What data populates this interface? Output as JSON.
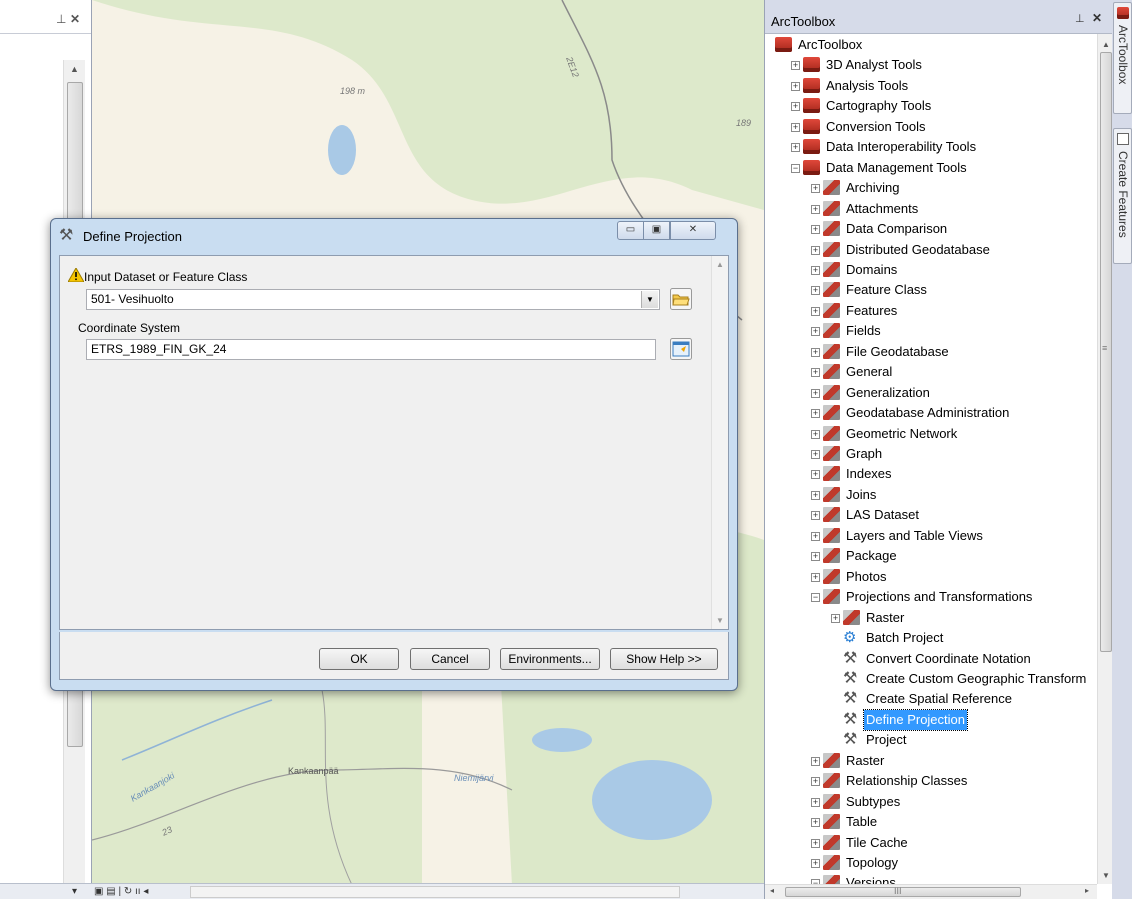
{
  "toc": {
    "pin": "⊥",
    "close": "✕"
  },
  "map": {
    "labels": {
      "elev1": "198 m",
      "elev2": "189",
      "road": "2E12",
      "town": "Kankaanpää",
      "lake": "Niemijärvi",
      "river": "Kankaanjoki",
      "road2": "23"
    },
    "colors": {
      "land": "#f6f2e6",
      "forest": "#c9dfb1",
      "water": "#a9c9e6",
      "road": "#8a8a8a"
    }
  },
  "statusbar": {
    "layout_icons": "▣ ▤ | ↻ ıı ◂"
  },
  "toolbox": {
    "title": "ArcToolbox",
    "pin": "⊥",
    "close": "✕",
    "tree": [
      {
        "label": "ArcToolbox",
        "level": 0,
        "icon": "toolbox-icon",
        "exp": ""
      },
      {
        "label": "3D Analyst Tools",
        "level": 1,
        "icon": "toolbox-icon",
        "exp": "+"
      },
      {
        "label": "Analysis Tools",
        "level": 1,
        "icon": "toolbox-icon",
        "exp": "+"
      },
      {
        "label": "Cartography Tools",
        "level": 1,
        "icon": "toolbox-icon",
        "exp": "+"
      },
      {
        "label": "Conversion Tools",
        "level": 1,
        "icon": "toolbox-icon",
        "exp": "+"
      },
      {
        "label": "Data Interoperability Tools",
        "level": 1,
        "icon": "toolbox-icon",
        "exp": "+"
      },
      {
        "label": "Data Management Tools",
        "level": 1,
        "icon": "toolbox-icon",
        "exp": "−"
      },
      {
        "label": "Archiving",
        "level": 2,
        "icon": "toolset-icon",
        "exp": "+"
      },
      {
        "label": "Attachments",
        "level": 2,
        "icon": "toolset-icon",
        "exp": "+"
      },
      {
        "label": "Data Comparison",
        "level": 2,
        "icon": "toolset-icon",
        "exp": "+"
      },
      {
        "label": "Distributed Geodatabase",
        "level": 2,
        "icon": "toolset-icon",
        "exp": "+"
      },
      {
        "label": "Domains",
        "level": 2,
        "icon": "toolset-icon",
        "exp": "+"
      },
      {
        "label": "Feature Class",
        "level": 2,
        "icon": "toolset-icon",
        "exp": "+"
      },
      {
        "label": "Features",
        "level": 2,
        "icon": "toolset-icon",
        "exp": "+"
      },
      {
        "label": "Fields",
        "level": 2,
        "icon": "toolset-icon",
        "exp": "+"
      },
      {
        "label": "File Geodatabase",
        "level": 2,
        "icon": "toolset-icon",
        "exp": "+"
      },
      {
        "label": "General",
        "level": 2,
        "icon": "toolset-icon",
        "exp": "+"
      },
      {
        "label": "Generalization",
        "level": 2,
        "icon": "toolset-icon",
        "exp": "+"
      },
      {
        "label": "Geodatabase Administration",
        "level": 2,
        "icon": "toolset-icon",
        "exp": "+"
      },
      {
        "label": "Geometric Network",
        "level": 2,
        "icon": "toolset-icon",
        "exp": "+"
      },
      {
        "label": "Graph",
        "level": 2,
        "icon": "toolset-icon",
        "exp": "+"
      },
      {
        "label": "Indexes",
        "level": 2,
        "icon": "toolset-icon",
        "exp": "+"
      },
      {
        "label": "Joins",
        "level": 2,
        "icon": "toolset-icon",
        "exp": "+"
      },
      {
        "label": "LAS Dataset",
        "level": 2,
        "icon": "toolset-icon",
        "exp": "+"
      },
      {
        "label": "Layers and Table Views",
        "level": 2,
        "icon": "toolset-icon",
        "exp": "+"
      },
      {
        "label": "Package",
        "level": 2,
        "icon": "toolset-icon",
        "exp": "+"
      },
      {
        "label": "Photos",
        "level": 2,
        "icon": "toolset-icon",
        "exp": "+"
      },
      {
        "label": "Projections and Transformations",
        "level": 2,
        "icon": "toolset-icon",
        "exp": "−"
      },
      {
        "label": "Raster",
        "level": 3,
        "icon": "toolset-icon",
        "exp": "+"
      },
      {
        "label": "Batch Project",
        "level": 3,
        "icon": "script-icon",
        "exp": ""
      },
      {
        "label": "Convert Coordinate Notation",
        "level": 3,
        "icon": "hammer-icon",
        "exp": ""
      },
      {
        "label": "Create Custom Geographic Transform",
        "level": 3,
        "icon": "hammer-icon",
        "exp": ""
      },
      {
        "label": "Create Spatial Reference",
        "level": 3,
        "icon": "hammer-icon",
        "exp": ""
      },
      {
        "label": "Define Projection",
        "level": 3,
        "icon": "hammer-icon",
        "exp": "",
        "selected": true
      },
      {
        "label": "Project",
        "level": 3,
        "icon": "hammer-icon",
        "exp": ""
      },
      {
        "label": "Raster",
        "level": 2,
        "icon": "toolset-icon",
        "exp": "+"
      },
      {
        "label": "Relationship Classes",
        "level": 2,
        "icon": "toolset-icon",
        "exp": "+"
      },
      {
        "label": "Subtypes",
        "level": 2,
        "icon": "toolset-icon",
        "exp": "+"
      },
      {
        "label": "Table",
        "level": 2,
        "icon": "toolset-icon",
        "exp": "+"
      },
      {
        "label": "Tile Cache",
        "level": 2,
        "icon": "toolset-icon",
        "exp": "+"
      },
      {
        "label": "Topology",
        "level": 2,
        "icon": "toolset-icon",
        "exp": "+"
      },
      {
        "label": "Versions",
        "level": 2,
        "icon": "toolset-icon",
        "exp": "−"
      }
    ],
    "hscroll_mid": "III",
    "vscroll_mid": "≡"
  },
  "dock": {
    "tab1": "ArcToolbox",
    "tab2": "Create Features"
  },
  "dialog": {
    "title": "Define Projection",
    "min": "▭",
    "max": "▣",
    "close": "✕",
    "param1_label": "Input Dataset or Feature Class",
    "param1_value": "501- Vesihuolto",
    "param2_label": "Coordinate System",
    "param2_value": "ETRS_1989_FIN_GK_24",
    "buttons": {
      "ok": "OK",
      "cancel": "Cancel",
      "env": "Environments...",
      "help": "Show Help >>"
    }
  }
}
